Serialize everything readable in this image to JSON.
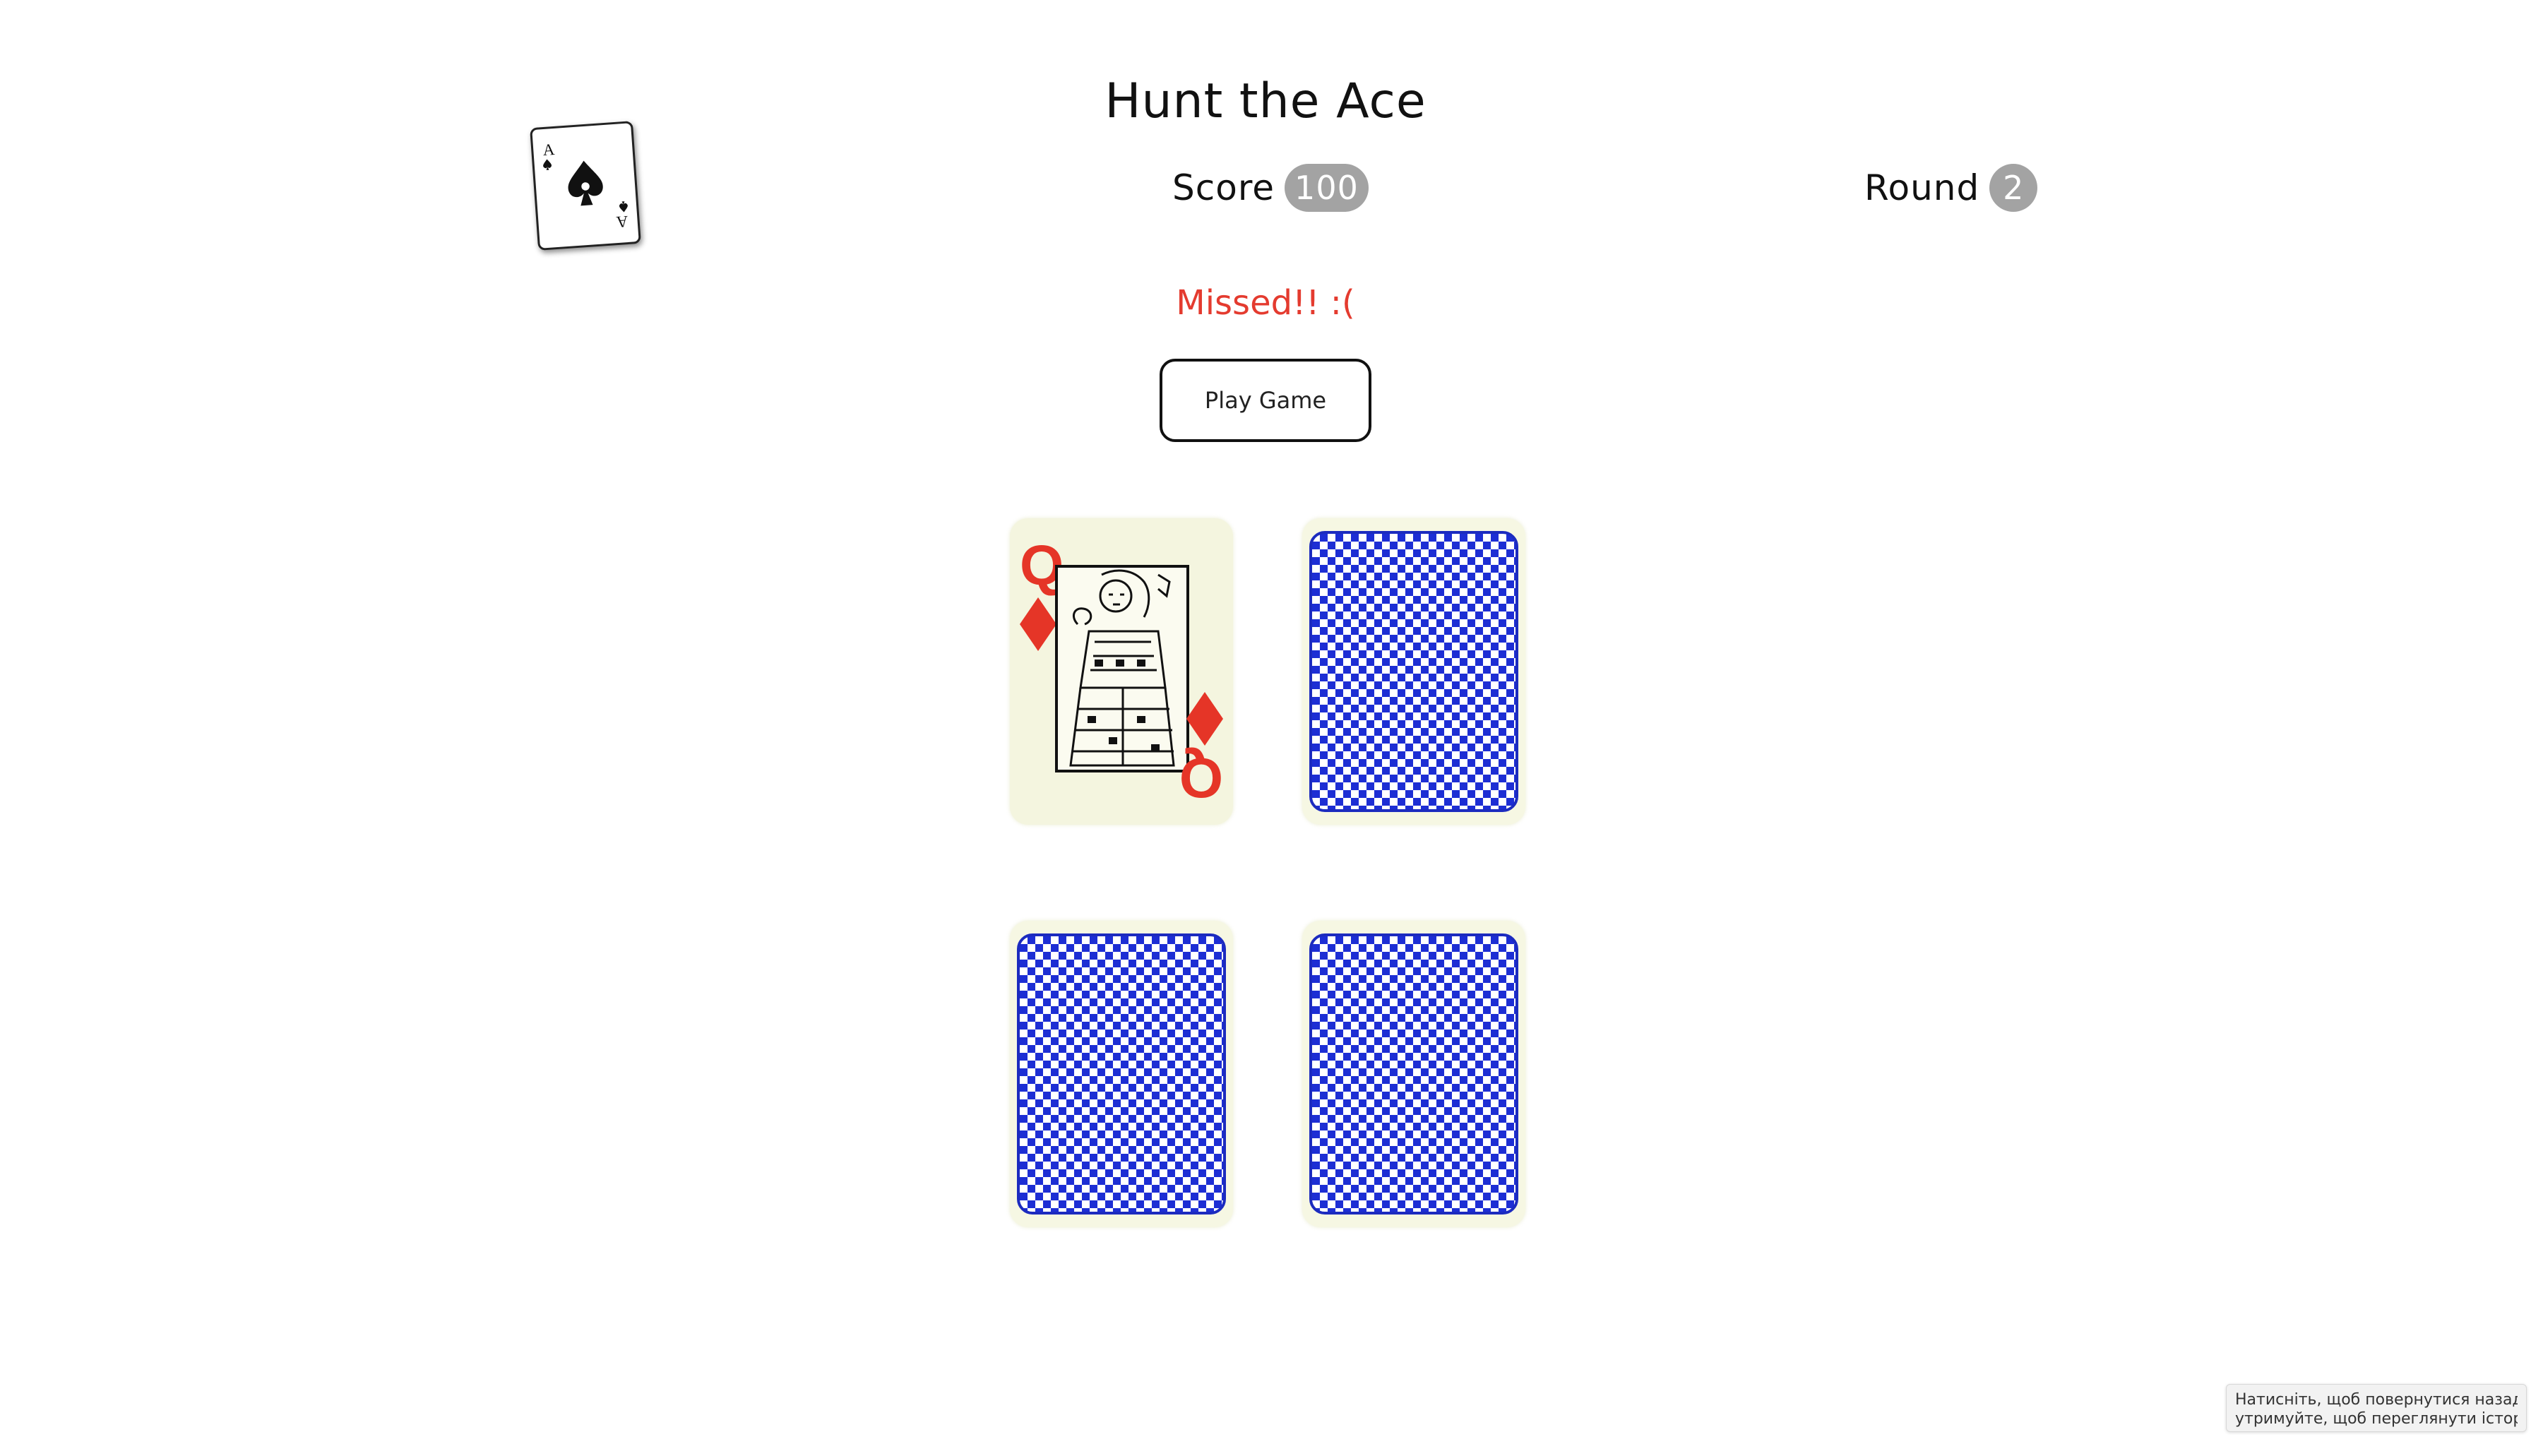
{
  "app": {
    "title": "Hunt the Ace"
  },
  "target_card": {
    "rank": "A",
    "suit": "spades",
    "icon": "ace-of-spades-icon"
  },
  "stats": {
    "score_label": "Score",
    "score_value": "100",
    "round_label": "Round",
    "round_value": "2"
  },
  "status": {
    "message": "Missed!! :(",
    "color": "#e43b2f"
  },
  "controls": {
    "play_label": "Play Game"
  },
  "cards": [
    {
      "id": 1,
      "face": "up",
      "rank": "Q",
      "suit": "diamonds",
      "icon": "queen-of-diamonds-icon"
    },
    {
      "id": 2,
      "face": "down",
      "icon": "card-back-icon"
    },
    {
      "id": 3,
      "face": "down",
      "icon": "card-back-icon"
    },
    {
      "id": 4,
      "face": "down",
      "icon": "card-back-icon"
    }
  ],
  "card_back_color": "#1d2ed4",
  "browser_tooltip": {
    "line1": "Натисніть, щоб повернутися назад;",
    "line2": "утримуйте, щоб переглянути історію"
  }
}
